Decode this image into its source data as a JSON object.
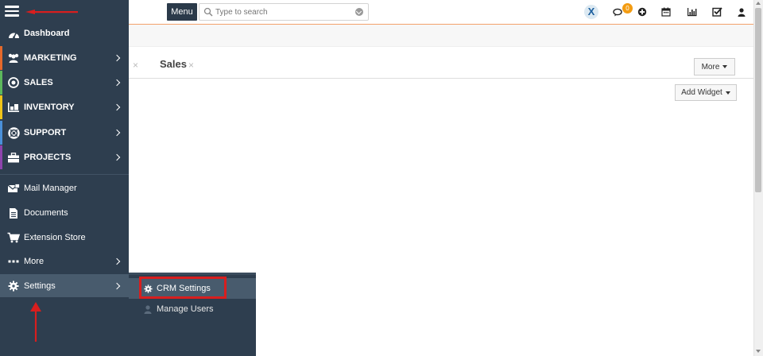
{
  "topbar": {
    "menu_label": "Menu",
    "search_placeholder": "Type to search",
    "notification_count": "0"
  },
  "tabs": {
    "sales_label": "Sales",
    "close_glyph": "×"
  },
  "toolbar": {
    "more_label": "More",
    "add_widget_label": "Add Widget"
  },
  "sidebar": {
    "items": [
      {
        "label": "Dashboard",
        "icon": "dashboard-icon"
      },
      {
        "label": "MARKETING",
        "icon": "users-icon",
        "accent": "#e5692b"
      },
      {
        "label": "SALES",
        "icon": "target-icon",
        "accent": "#5cb85c"
      },
      {
        "label": "INVENTORY",
        "icon": "inventory-icon",
        "accent": "#f0c419"
      },
      {
        "label": "SUPPORT",
        "icon": "lifebuoy-icon",
        "accent": "#4a90d9"
      },
      {
        "label": "PROJECTS",
        "icon": "briefcase-icon",
        "accent": "#8e44ad"
      },
      {
        "label": "Mail Manager",
        "icon": "mail-icon"
      },
      {
        "label": "Documents",
        "icon": "document-icon"
      },
      {
        "label": "Extension Store",
        "icon": "cart-icon"
      },
      {
        "label": "More",
        "icon": "ellipsis-icon"
      },
      {
        "label": "Settings",
        "icon": "gear-icon"
      }
    ]
  },
  "submenu": {
    "items": [
      {
        "label": "CRM Settings",
        "icon": "gear-icon"
      },
      {
        "label": "Manage Users",
        "icon": "user-icon"
      }
    ]
  },
  "colors": {
    "sidebar_bg": "#2e3e4f",
    "highlight": "#485b6d",
    "annotation_red": "#d81e1e",
    "badge": "#f39c12"
  }
}
